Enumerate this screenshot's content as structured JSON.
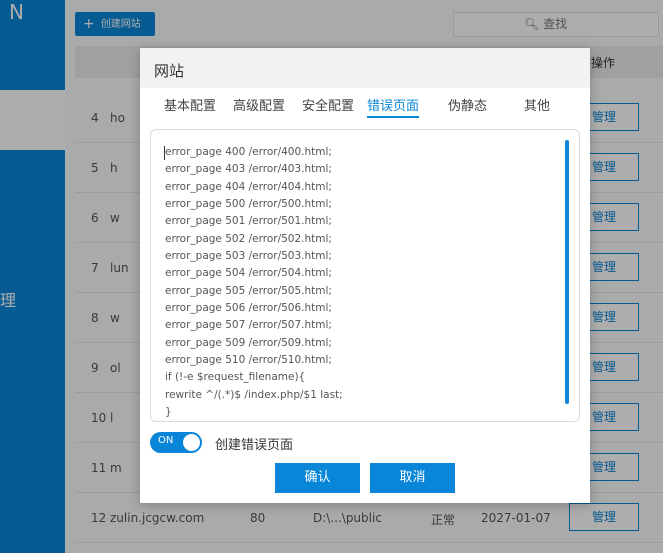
{
  "sidebar": {
    "logo": "N",
    "nav_partial": "",
    "nav_manage": "理"
  },
  "toolbar": {
    "create_label": "创建网站",
    "search_label": "查找"
  },
  "table": {
    "op_header": "操作",
    "manage_label": "管理",
    "rows": [
      {
        "id": "4",
        "name": "ho",
        "port": "",
        "path": "",
        "status": "",
        "date": ""
      },
      {
        "id": "5",
        "name": "h",
        "port": "",
        "path": "",
        "status": "",
        "date": ""
      },
      {
        "id": "6",
        "name": "w",
        "port": "",
        "path": "",
        "status": "",
        "date": ""
      },
      {
        "id": "7",
        "name": "lun",
        "port": "",
        "path": "",
        "status": "",
        "date": ""
      },
      {
        "id": "8",
        "name": "w",
        "port": "",
        "path": "",
        "status": "",
        "date": ""
      },
      {
        "id": "9",
        "name": "ol",
        "port": "",
        "path": "",
        "status": "",
        "date": ""
      },
      {
        "id": "10",
        "name": "l",
        "port": "",
        "path": "",
        "status": "",
        "date": ""
      },
      {
        "id": "11",
        "name": "m",
        "port": "",
        "path": "",
        "status": "",
        "date": ""
      },
      {
        "id": "12",
        "name": "zulin.jcgcw.com",
        "port": "80",
        "path": "D:\\...\\public",
        "status": "正常",
        "date": "2027-01-07"
      }
    ]
  },
  "modal": {
    "title": "网站",
    "tabs": [
      {
        "label": "基本配置"
      },
      {
        "label": "高级配置"
      },
      {
        "label": "安全配置"
      },
      {
        "label": "错误页面"
      },
      {
        "label": "伪静态"
      },
      {
        "label": "其他"
      }
    ],
    "active_tab": "错误页面",
    "editor_text": "error_page 400 /error/400.html;\nerror_page 403 /error/403.html;\nerror_page 404 /error/404.html;\nerror_page 500 /error/500.html;\nerror_page 501 /error/501.html;\nerror_page 502 /error/502.html;\nerror_page 503 /error/503.html;\nerror_page 504 /error/504.html;\nerror_page 505 /error/505.html;\nerror_page 506 /error/506.html;\nerror_page 507 /error/507.html;\nerror_page 509 /error/509.html;\nerror_page 510 /error/510.html;\nif (!-e $request_filename){\nrewrite ^/(.*)$ /index.php/$1 last;\n}",
    "toggle_state": "ON",
    "toggle_label": "创建错误页面",
    "confirm_label": "确认",
    "cancel_label": "取消"
  },
  "colors": {
    "accent": "#0a86d8",
    "overlay": "rgba(0,0,0,0.32)"
  }
}
